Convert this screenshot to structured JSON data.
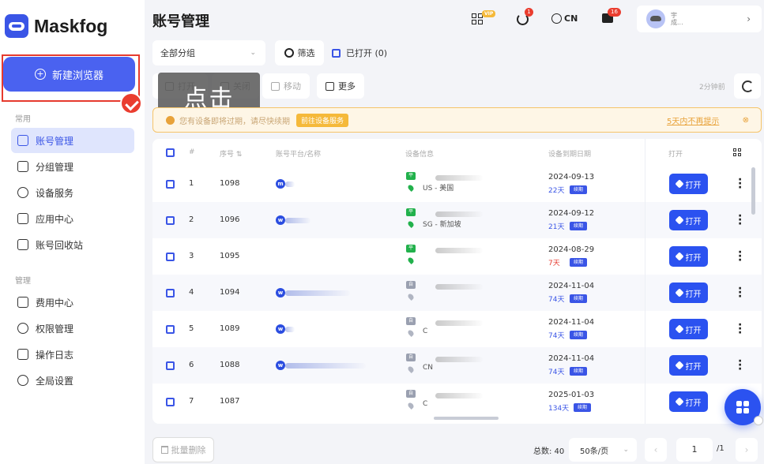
{
  "app": {
    "name": "Maskfog"
  },
  "sidebar": {
    "new_button": "新建浏览器",
    "section_common": "常用",
    "common_items": [
      {
        "label": "账号管理",
        "icon": "folder-icon",
        "active": true
      },
      {
        "label": "分组管理",
        "icon": "folder-open-icon"
      },
      {
        "label": "设备服务",
        "icon": "location-icon"
      },
      {
        "label": "应用中心",
        "icon": "cube-icon"
      },
      {
        "label": "账号回收站",
        "icon": "trash-icon"
      }
    ],
    "section_manage": "管理",
    "manage_items": [
      {
        "label": "费用中心",
        "icon": "dollar-icon"
      },
      {
        "label": "权限管理",
        "icon": "shield-icon"
      },
      {
        "label": "操作日志",
        "icon": "clipboard-icon"
      },
      {
        "label": "全局设置",
        "icon": "settings-icon"
      }
    ]
  },
  "header": {
    "title": "账号管理",
    "vip": "VIP",
    "sync_badge": "1",
    "language": "CN",
    "messages_count": "16",
    "user_line1": "宇",
    "user_line2": "成..."
  },
  "toolbar": {
    "group_select": "全部分组",
    "filter": "筛选",
    "opened": "已打开 (0)",
    "open": "打开",
    "close": "关闭",
    "move": "移动",
    "more": "更多",
    "tooltip": "点击",
    "time_ago": "2分钟前"
  },
  "warning": {
    "text": "您有设备即将过期，请尽快续期",
    "link": "前往设备服务",
    "dismiss": "5天内不再提示",
    "close": "⊗"
  },
  "table": {
    "headers": {
      "index": "#",
      "serial": "序号 ⇅",
      "platform": "账号平台/名称",
      "device": "设备信息",
      "expiry": "设备到期日期",
      "open": "打开"
    },
    "renew_label": "续期",
    "open_label": "打开",
    "rows": [
      {
        "index": "1",
        "serial": "1098",
        "platform_icon": "m",
        "tag": "平",
        "tag_color": "green",
        "location": "US - 美国",
        "date": "2024-09-13",
        "days": "22天",
        "days_red": false
      },
      {
        "index": "2",
        "serial": "1096",
        "platform_icon": "w",
        "tag": "平",
        "tag_color": "green",
        "location": "SG - 新加坡",
        "date": "2024-09-12",
        "days": "21天",
        "days_red": false
      },
      {
        "index": "3",
        "serial": "1095",
        "platform_icon": "",
        "tag": "平",
        "tag_color": "green",
        "location": "",
        "date": "2024-08-29",
        "days": "7天",
        "days_red": true
      },
      {
        "index": "4",
        "serial": "1094",
        "platform_icon": "w",
        "tag": "自",
        "tag_color": "gray",
        "location": "",
        "date": "2024-11-04",
        "days": "74天",
        "days_red": false
      },
      {
        "index": "5",
        "serial": "1089",
        "platform_icon": "w",
        "tag": "自",
        "tag_color": "gray",
        "location": "C",
        "date": "2024-11-04",
        "days": "74天",
        "days_red": false
      },
      {
        "index": "6",
        "serial": "1088",
        "platform_icon": "w",
        "tag": "自",
        "tag_color": "gray",
        "location": "CN",
        "date": "2024-11-04",
        "days": "74天",
        "days_red": false
      },
      {
        "index": "7",
        "serial": "1087",
        "platform_icon": "",
        "tag": "自",
        "tag_color": "gray",
        "location": "C",
        "date": "2025-01-03",
        "days": "134天",
        "days_red": false
      }
    ]
  },
  "footer": {
    "bulk_delete": "批量删除",
    "total": "总数: 40",
    "per_page": "50条/页",
    "prev": "‹",
    "page": "1",
    "page_total": "/1",
    "next": "›"
  }
}
